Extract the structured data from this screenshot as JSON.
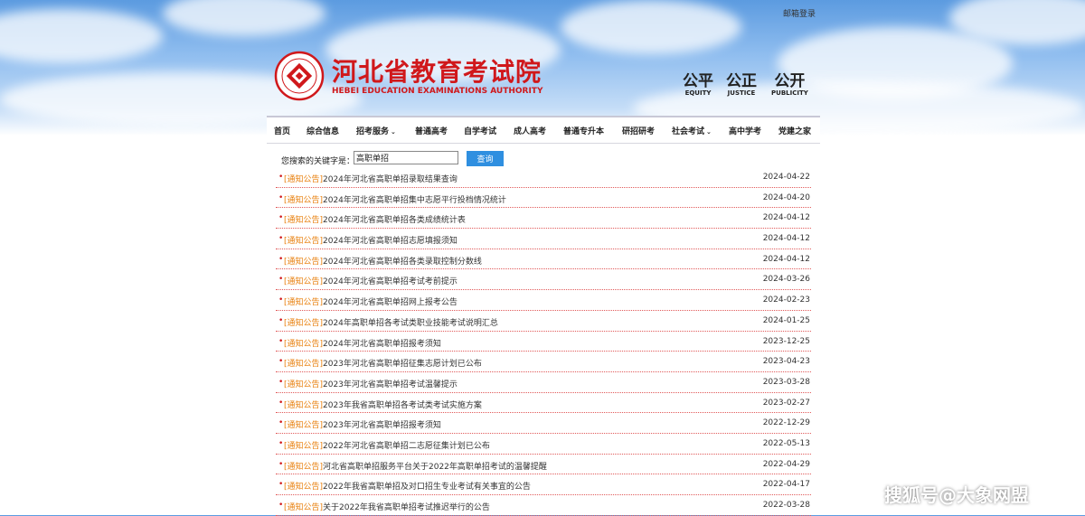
{
  "header": {
    "mailbox_link": "邮箱登录",
    "logo_cn": "河北省教育考试院",
    "logo_en": "HEBEI EDUCATION EXAMINATIONS AUTHORITY",
    "mottos": [
      {
        "cn": "公平",
        "en": "EQUITY"
      },
      {
        "cn": "公正",
        "en": "JUSTICE"
      },
      {
        "cn": "公开",
        "en": "PUBLICITY"
      }
    ]
  },
  "nav": [
    {
      "label": "首页",
      "dropdown": false
    },
    {
      "label": "综合信息",
      "dropdown": false
    },
    {
      "label": "招考服务",
      "dropdown": true
    },
    {
      "label": "普通高考",
      "dropdown": false
    },
    {
      "label": "自学考试",
      "dropdown": false
    },
    {
      "label": "成人高考",
      "dropdown": false
    },
    {
      "label": "普通专升本",
      "dropdown": false
    },
    {
      "label": "研招研考",
      "dropdown": false
    },
    {
      "label": "社会考试",
      "dropdown": true
    },
    {
      "label": "高中学考",
      "dropdown": false
    },
    {
      "label": "党建之家",
      "dropdown": false
    }
  ],
  "search": {
    "label": "您搜索的关键字是：",
    "value": "高职单招",
    "button_label": "查询"
  },
  "results": [
    {
      "tag": "[通知公告]",
      "title": "2024年河北省高职单招录取结果查询",
      "date": "2024-04-22"
    },
    {
      "tag": "[通知公告]",
      "title": "2024年河北省高职单招集中志愿平行投档情况统计",
      "date": "2024-04-20"
    },
    {
      "tag": "[通知公告]",
      "title": "2024年河北省高职单招各类成绩统计表",
      "date": "2024-04-12"
    },
    {
      "tag": "[通知公告]",
      "title": "2024年河北省高职单招志愿填报须知",
      "date": "2024-04-12"
    },
    {
      "tag": "[通知公告]",
      "title": "2024年河北省高职单招各类录取控制分数线",
      "date": "2024-04-12"
    },
    {
      "tag": "[通知公告]",
      "title": "2024年河北省高职单招考试考前提示",
      "date": "2024-03-26"
    },
    {
      "tag": "[通知公告]",
      "title": "2024年河北省高职单招网上报考公告",
      "date": "2024-02-23"
    },
    {
      "tag": "[通知公告]",
      "title": "2024年高职单招各考试类职业技能考试说明汇总",
      "date": "2024-01-25"
    },
    {
      "tag": "[通知公告]",
      "title": "2024年河北省高职单招报考须知",
      "date": "2023-12-25"
    },
    {
      "tag": "[通知公告]",
      "title": "2023年河北省高职单招征集志愿计划已公布",
      "date": "2023-04-23"
    },
    {
      "tag": "[通知公告]",
      "title": "2023年河北省高职单招考试温馨提示",
      "date": "2023-03-28"
    },
    {
      "tag": "[通知公告]",
      "title": "2023年我省高职单招各考试类考试实施方案",
      "date": "2023-02-27"
    },
    {
      "tag": "[通知公告]",
      "title": "2023年河北省高职单招报考须知",
      "date": "2022-12-29"
    },
    {
      "tag": "[通知公告]",
      "title": "2022年河北省高职单招二志愿征集计划已公布",
      "date": "2022-05-13"
    },
    {
      "tag": "[通知公告]",
      "title": "河北省高职单招服务平台关于2022年高职单招考试的温馨提醒",
      "date": "2022-04-29"
    },
    {
      "tag": "[通知公告]",
      "title": "2022年我省高职单招及对口招生专业考试有关事宜的公告",
      "date": "2022-04-17"
    },
    {
      "tag": "[通知公告]",
      "title": "关于2022年我省高职单招考试推迟举行的公告",
      "date": "2022-03-28"
    }
  ],
  "watermark": "搜狐号@大象网盟",
  "colors": {
    "brand_red": "#d0181b",
    "tag_orange": "#e87f0c",
    "button_blue": "#2f8fe0"
  }
}
